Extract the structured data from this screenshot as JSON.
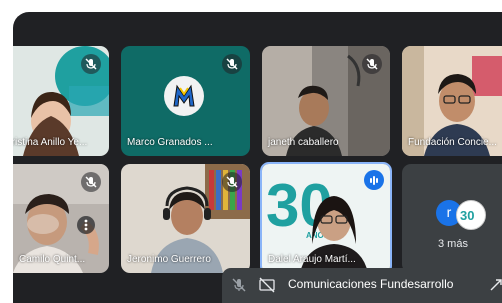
{
  "participants": [
    {
      "name": "Kristina Anillo Ye...",
      "muted": true
    },
    {
      "name": "Marco Granados ...",
      "muted": true
    },
    {
      "name": "janeth caballero",
      "muted": true
    },
    {
      "name": "Fundación Concie...",
      "muted": false
    },
    {
      "name": "Camilo Quint...",
      "muted": true
    },
    {
      "name": "Jeronimo Guerrero",
      "muted": true
    },
    {
      "name": "Dalel Araujo Martí...",
      "muted": false,
      "speaking": true
    }
  ],
  "overflow": {
    "avatar_letter": "r",
    "label": "3 más"
  },
  "presenting_bar": {
    "label": "Comunicaciones Fundesarrollo"
  },
  "logo_text": {
    "number": "30",
    "word": "AÑOS"
  },
  "colors": {
    "stage": "#202124",
    "tile": "#3c4043",
    "accent": "#1a73e8",
    "teal": "#1fa0a0"
  },
  "icons": [
    "mic-off-icon",
    "speaking-indicator-icon",
    "present-off-icon",
    "expand-icon",
    "more-options-icon"
  ]
}
